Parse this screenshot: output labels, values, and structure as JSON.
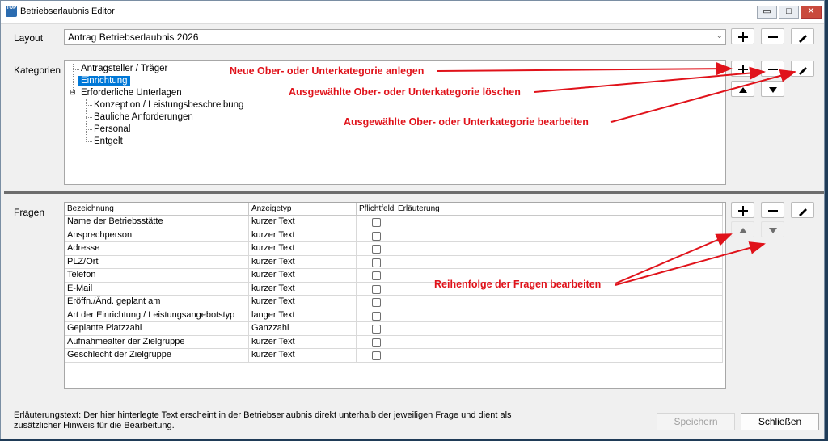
{
  "window": {
    "title": "Betriebserlaubnis Editor",
    "min": "▭",
    "max": "□",
    "close": "✕",
    "app_icon": "TOP"
  },
  "layout": {
    "label": "Layout",
    "value": "Antrag Betriebserlaubnis 2026"
  },
  "kategorien": {
    "label": "Kategorien",
    "tree": [
      {
        "label": "Antragsteller / Träger"
      },
      {
        "label": "Einrichtung",
        "selected": true
      },
      {
        "label": "Erforderliche Unterlagen",
        "expander": "⊟"
      },
      {
        "label": "Konzeption / Leistungsbeschreibung"
      },
      {
        "label": "Bauliche Anforderungen"
      },
      {
        "label": "Personal"
      },
      {
        "label": "Entgelt"
      }
    ]
  },
  "fragen": {
    "label": "Fragen",
    "columns": [
      "Bezeichnung",
      "Anzeigetyp",
      "Pflichtfeld",
      "Erläuterung"
    ],
    "rows": [
      {
        "bezeichnung": "Name der Betriebsstätte",
        "typ": "kurzer Text",
        "pflicht": false
      },
      {
        "bezeichnung": "Ansprechperson",
        "typ": "kurzer Text",
        "pflicht": false
      },
      {
        "bezeichnung": "Adresse",
        "typ": "kurzer Text",
        "pflicht": false
      },
      {
        "bezeichnung": "PLZ/Ort",
        "typ": "kurzer Text",
        "pflicht": false
      },
      {
        "bezeichnung": "Telefon",
        "typ": "kurzer Text",
        "pflicht": false
      },
      {
        "bezeichnung": "E-Mail",
        "typ": "kurzer Text",
        "pflicht": false
      },
      {
        "bezeichnung": "Eröffn./Änd. geplant am",
        "typ": "kurzer Text",
        "pflicht": false
      },
      {
        "bezeichnung": "Art der Einrichtung / Leistungsangebotstyp",
        "typ": "langer Text",
        "pflicht": false
      },
      {
        "bezeichnung": "Geplante Platzzahl",
        "typ": "Ganzzahl",
        "pflicht": false
      },
      {
        "bezeichnung": "Aufnahmealter der Zielgruppe",
        "typ": "kurzer Text",
        "pflicht": false
      },
      {
        "bezeichnung": "Geschlecht der Zielgruppe",
        "typ": "kurzer Text",
        "pflicht": false
      }
    ]
  },
  "annotations": {
    "neu": "Neue Ober- oder Unterkategorie anlegen",
    "loeschen": "Ausgewählte Ober- oder Unterkategorie löschen",
    "bearbeiten": "Ausgewählte Ober- oder Unterkategorie bearbeiten",
    "reihenfolge": "Reihenfolge der Fragen bearbeiten"
  },
  "footer": {
    "hint": "Erläuterungstext: Der hier hinterlegte Text erscheint in der Betriebserlaubnis direkt unterhalb der jeweiligen Frage und dient als zusätzlicher Hinweis für die Bearbeitung.",
    "speichern": "Speichern",
    "schliessen": "Schließen"
  },
  "colors": {
    "annotation": "#e0121a",
    "selection": "#0078d7"
  },
  "icons": [
    "plus-icon",
    "minus-icon",
    "pencil-icon",
    "arrow-up-icon",
    "arrow-down-icon",
    "chevron-down-icon"
  ]
}
